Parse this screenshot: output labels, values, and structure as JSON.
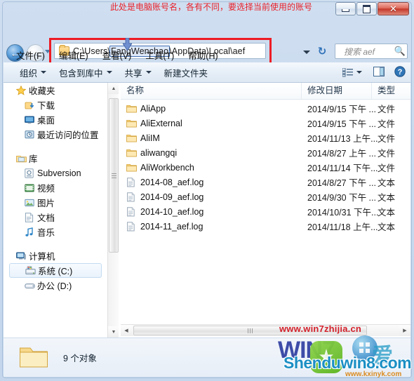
{
  "window": {
    "annotation_top": "此处是电脑账号名，各有不同，要选择当前使用的账号",
    "annotation_color": "#e8212a",
    "highlight_box_color": "#ed1c24",
    "minimize_label": "最小化",
    "maximize_label": "最大化",
    "close_label": "关闭"
  },
  "address_bar": {
    "back_label": "后退",
    "forward_label": "前进",
    "recent_pages_label": "最近访问的页面",
    "path_prefix": "C:\\Users\\",
    "path_account": "FangWenchao",
    "path_suffix": "\\AppData\\Local\\aef",
    "full_path": "C:\\Users\\FangWenchao\\AppData\\Local\\aef",
    "refresh_label": "刷新",
    "dropdown_label": "历史位置"
  },
  "search": {
    "placeholder": "搜索 aef",
    "icon": "search-icon"
  },
  "menu": {
    "items": [
      {
        "label": "文件(F)"
      },
      {
        "label": "编辑(E)"
      },
      {
        "label": "查看(V)"
      },
      {
        "label": "工具(T)"
      },
      {
        "label": "帮助(H)"
      }
    ]
  },
  "toolbar": {
    "organize_label": "组织",
    "include_library_label": "包含到库中",
    "share_label": "共享",
    "new_folder_label": "新建文件夹",
    "view_icon": "list-view-icon",
    "preview_pane_icon": "preview-pane-icon",
    "help_icon": "help-icon"
  },
  "nav_pane": {
    "groups": [
      {
        "header": {
          "label": "收藏夹",
          "icon": "star-icon"
        },
        "items": [
          {
            "label": "下载",
            "icon": "download-icon"
          },
          {
            "label": "桌面",
            "icon": "desktop-icon"
          },
          {
            "label": "最近访问的位置",
            "icon": "recent-places-icon"
          }
        ]
      },
      {
        "header": {
          "label": "库",
          "icon": "library-icon"
        },
        "items": [
          {
            "label": "Subversion",
            "icon": "subversion-icon"
          },
          {
            "label": "视频",
            "icon": "video-icon"
          },
          {
            "label": "图片",
            "icon": "pictures-icon"
          },
          {
            "label": "文档",
            "icon": "documents-icon"
          },
          {
            "label": "音乐",
            "icon": "music-icon"
          }
        ]
      },
      {
        "header": {
          "label": "计算机",
          "icon": "computer-icon"
        },
        "items": [
          {
            "label": "系统 (C:)",
            "icon": "system-drive-icon",
            "selected": true
          },
          {
            "label": "办公 (D:)",
            "icon": "drive-icon",
            "selected": false
          }
        ]
      }
    ]
  },
  "file_list": {
    "columns": [
      {
        "label": "名称"
      },
      {
        "label": "修改日期"
      },
      {
        "label": "类型"
      }
    ],
    "rows": [
      {
        "name": "AliApp",
        "date": "2014/9/15 下午 ...",
        "type": "文件",
        "icon": "folder-icon"
      },
      {
        "name": "AliExternal",
        "date": "2014/9/15 下午 ...",
        "type": "文件",
        "icon": "folder-icon"
      },
      {
        "name": "AliIM",
        "date": "2014/11/13 上午...",
        "type": "文件",
        "icon": "folder-icon"
      },
      {
        "name": "aliwangqi",
        "date": "2014/8/27 上午 ...",
        "type": "文件",
        "icon": "folder-icon"
      },
      {
        "name": "AliWorkbench",
        "date": "2014/11/14 下午...",
        "type": "文件",
        "icon": "folder-icon"
      },
      {
        "name": "2014-08_aef.log",
        "date": "2014/8/27 下午 ...",
        "type": "文本",
        "icon": "log-file-icon"
      },
      {
        "name": "2014-09_aef.log",
        "date": "2014/9/30 下午 ...",
        "type": "文本",
        "icon": "log-file-icon"
      },
      {
        "name": "2014-10_aef.log",
        "date": "2014/10/31 下午...",
        "type": "文本",
        "icon": "log-file-icon"
      },
      {
        "name": "2014-11_aef.log",
        "date": "2014/11/18 上午...",
        "type": "文本",
        "icon": "log-file-icon"
      }
    ]
  },
  "status_bar": {
    "item_count_text": "9 个对象",
    "icon": "folder-icon"
  },
  "watermarks": {
    "url_top": "www.win7zhijia.cn",
    "win7_text": "WIN7",
    "shenduwin8_text": "Shenduwin8.com",
    "kxinyk_text": "www.kxinyk.com",
    "ai_char": "爱"
  }
}
